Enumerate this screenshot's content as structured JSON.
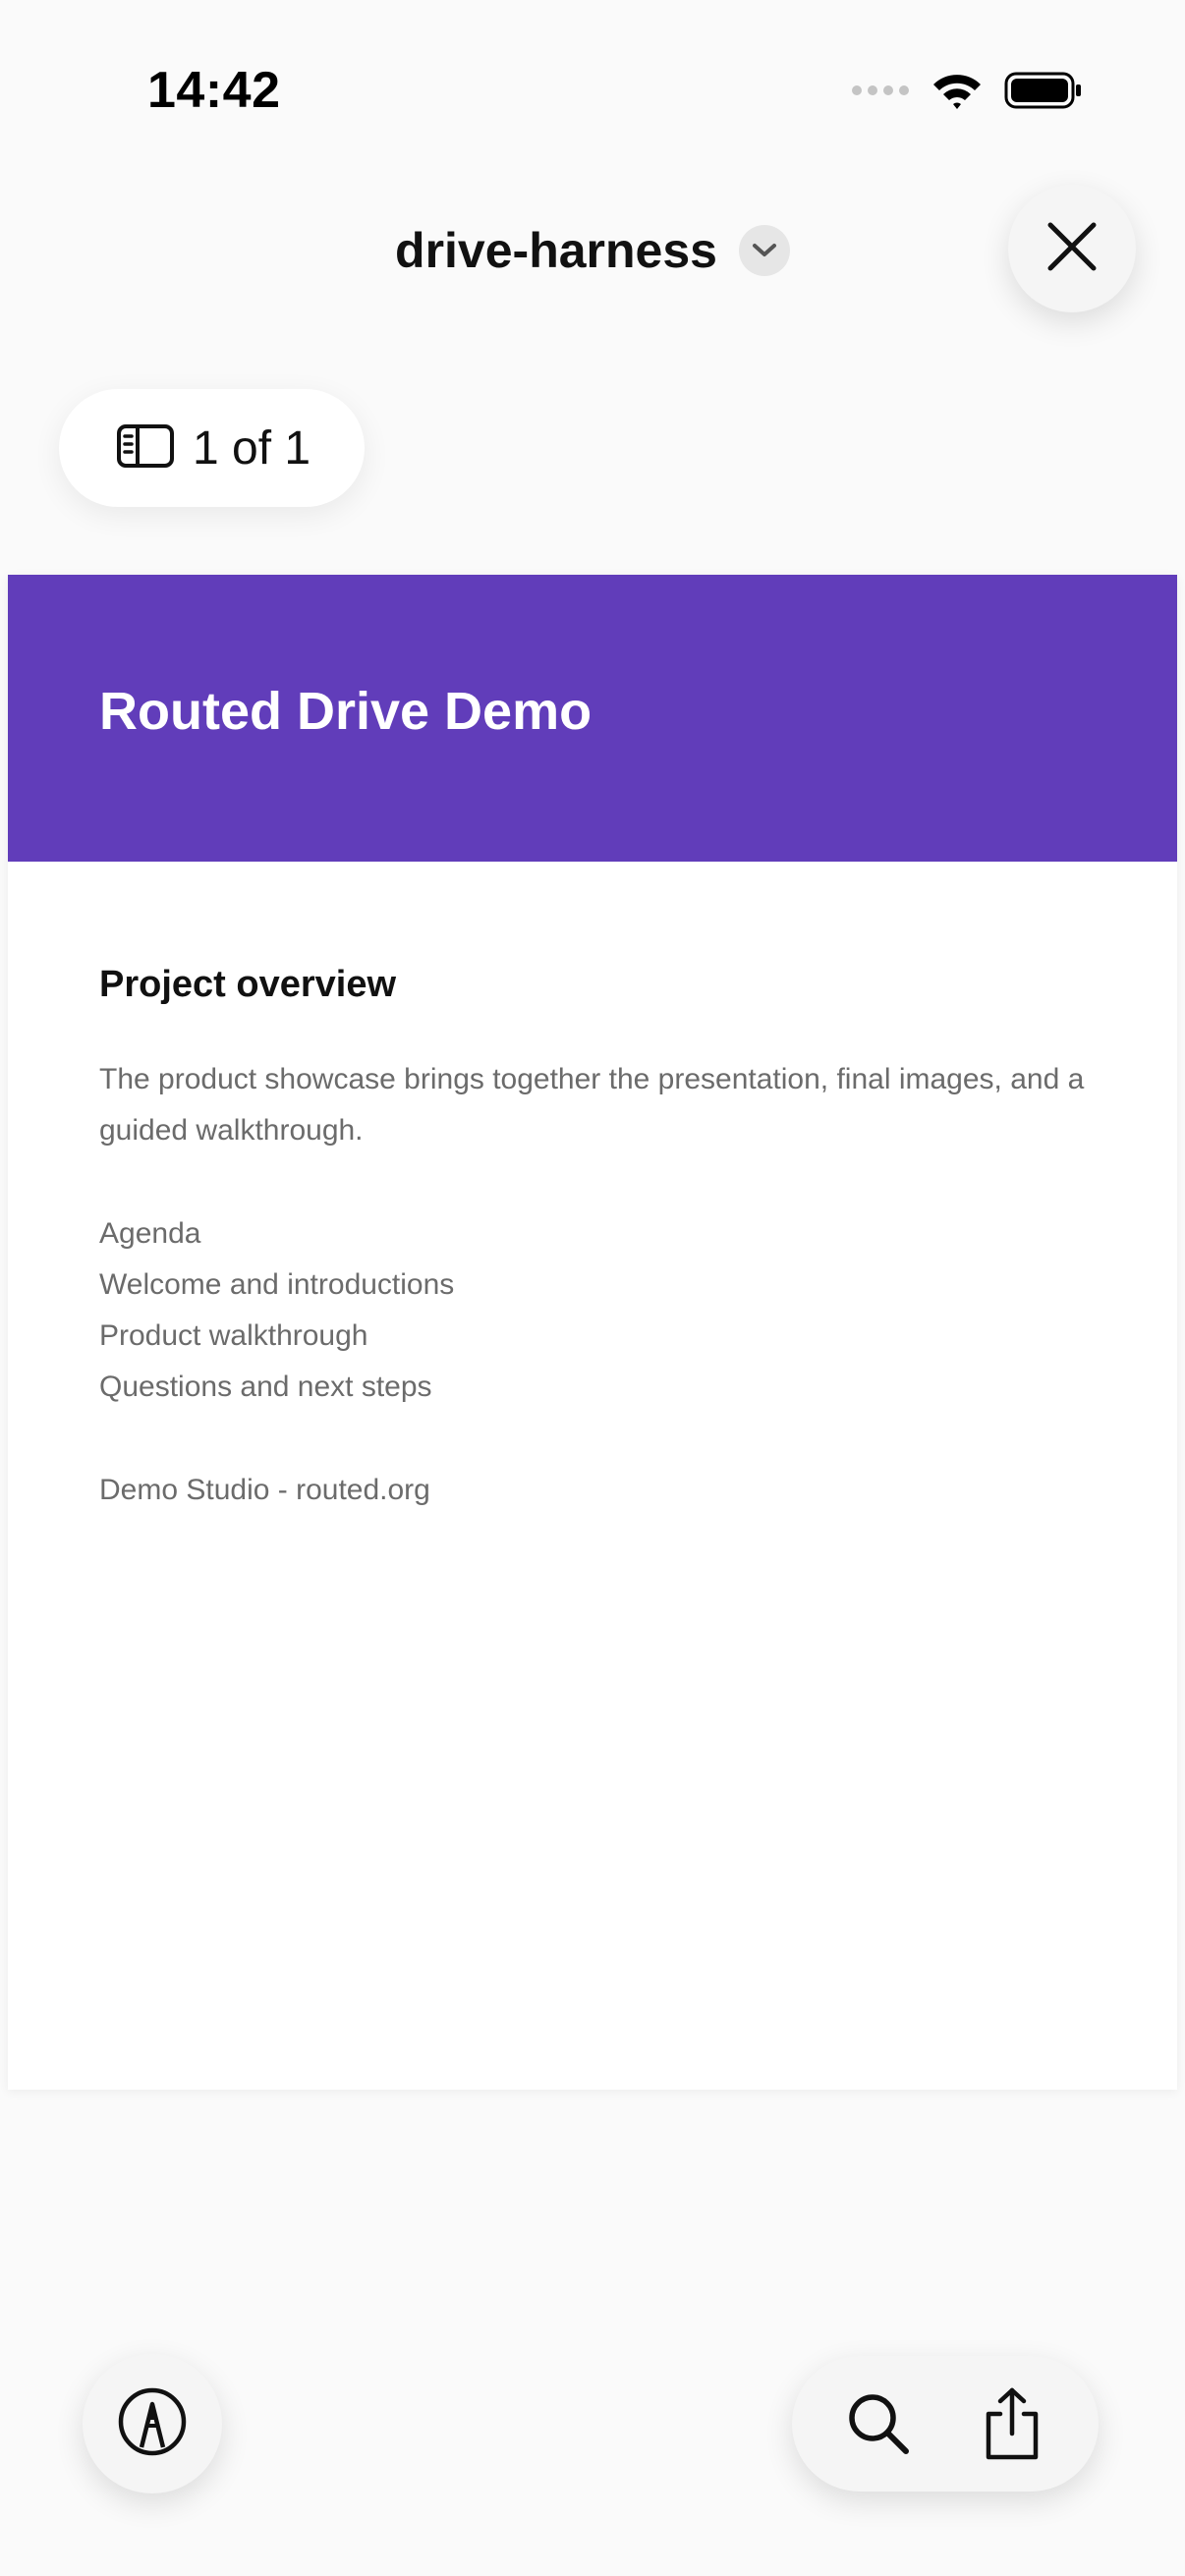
{
  "status_bar": {
    "time": "14:42",
    "signal_icon": "cellular-dots-icon",
    "wifi_icon": "wifi-icon",
    "battery_icon": "battery-icon"
  },
  "header": {
    "title": "drive-harness",
    "chevron_icon": "chevron-down-icon",
    "close_icon": "close-icon"
  },
  "page_counter": {
    "icon": "sidebar-icon",
    "label": "1 of 1"
  },
  "document": {
    "banner_color": "#613dba",
    "banner_title": "Routed Drive Demo",
    "section_heading": "Project overview",
    "paragraph": "The product showcase brings together the presentation, final images, and a guided walkthrough.",
    "agenda": [
      "Agenda",
      "Welcome and introductions",
      "Product walkthrough",
      "Questions and next steps"
    ],
    "footer": "Demo Studio - routed.org"
  },
  "toolbar": {
    "markup_icon": "markup-pen-icon",
    "search_icon": "search-icon",
    "share_icon": "share-icon"
  }
}
